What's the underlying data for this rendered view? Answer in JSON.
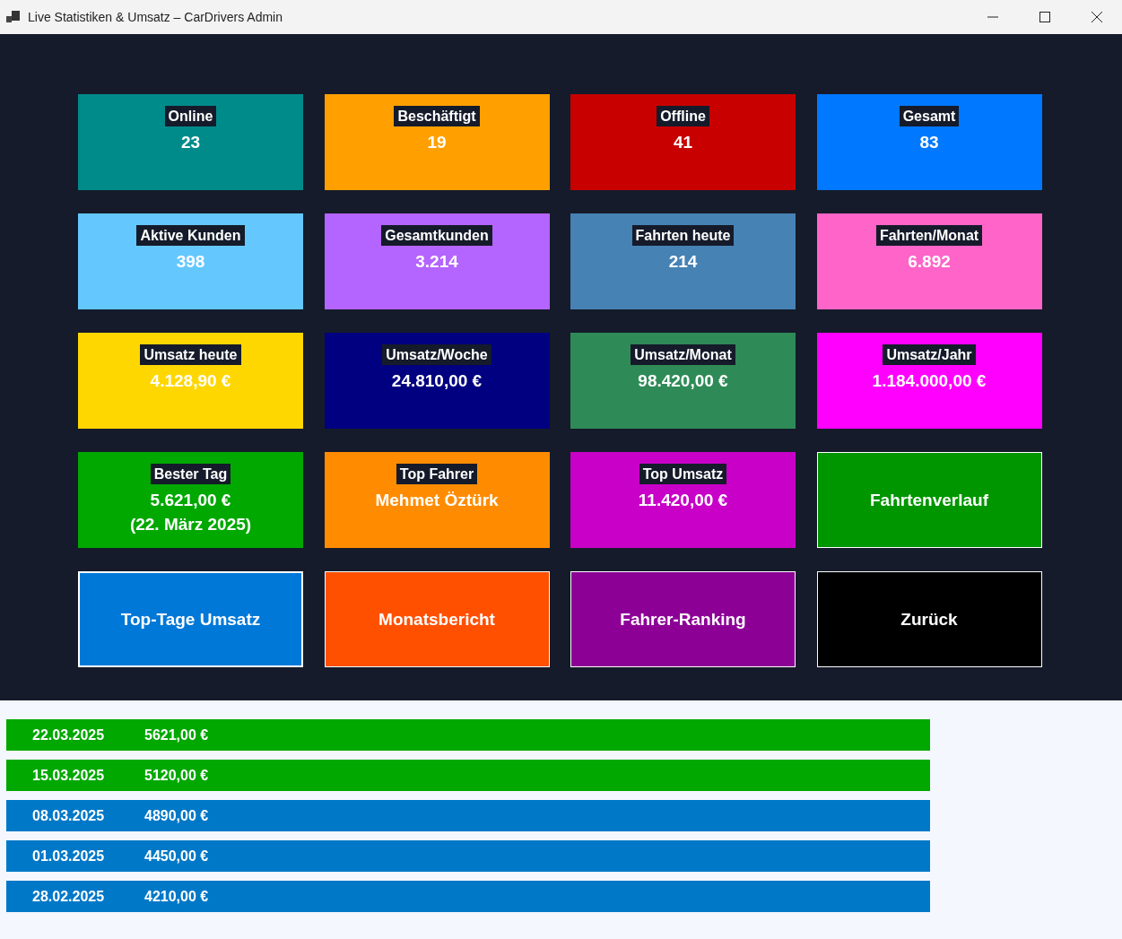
{
  "window": {
    "title": "Live Statistiken & Umsatz – CarDrivers Admin"
  },
  "tiles": [
    {
      "kind": "stat",
      "label": "Online",
      "lines": [
        "23"
      ],
      "color": "#008b8b"
    },
    {
      "kind": "stat",
      "label": "Beschäftigt",
      "lines": [
        "19"
      ],
      "color": "#ffa000"
    },
    {
      "kind": "stat",
      "label": "Offline",
      "lines": [
        "41"
      ],
      "color": "#c80000"
    },
    {
      "kind": "stat",
      "label": "Gesamt",
      "lines": [
        "83"
      ],
      "color": "#0078ff"
    },
    {
      "kind": "stat",
      "label": "Aktive Kunden",
      "lines": [
        "398"
      ],
      "color": "#64c8ff"
    },
    {
      "kind": "stat",
      "label": "Gesamtkunden",
      "lines": [
        "3.214"
      ],
      "color": "#b464ff"
    },
    {
      "kind": "stat",
      "label": "Fahrten heute",
      "lines": [
        "214"
      ],
      "color": "#4682b4"
    },
    {
      "kind": "stat",
      "label": "Fahrten/Monat",
      "lines": [
        "6.892"
      ],
      "color": "#ff64c8"
    },
    {
      "kind": "stat",
      "label": "Umsatz heute",
      "lines": [
        "4.128,90 €"
      ],
      "color": "#ffd700"
    },
    {
      "kind": "stat",
      "label": "Umsatz/Woche",
      "lines": [
        "24.810,00 €"
      ],
      "color": "#000080"
    },
    {
      "kind": "stat",
      "label": "Umsatz/Monat",
      "lines": [
        "98.420,00 €"
      ],
      "color": "#2e8b57"
    },
    {
      "kind": "stat",
      "label": "Umsatz/Jahr",
      "lines": [
        "1.184.000,00 €"
      ],
      "color": "#ff00ff"
    },
    {
      "kind": "stat",
      "label": "Bester Tag",
      "lines": [
        "5.621,00 €",
        "(22. März 2025)"
      ],
      "color": "#00a800"
    },
    {
      "kind": "stat",
      "label": "Top Fahrer",
      "lines": [
        "Mehmet Öztürk"
      ],
      "color": "#ff8c00"
    },
    {
      "kind": "stat",
      "label": "Top Umsatz",
      "lines": [
        "11.420,00 €"
      ],
      "color": "#c800c8"
    },
    {
      "kind": "button",
      "label": "Fahrtenverlauf",
      "color": "#009600",
      "selected": false
    },
    {
      "kind": "button",
      "label": "Top-Tage Umsatz",
      "color": "#0078d7",
      "selected": true
    },
    {
      "kind": "button",
      "label": "Monatsbericht",
      "color": "#ff5000",
      "selected": false
    },
    {
      "kind": "button",
      "label": "Fahrer-Ranking",
      "color": "#8c0096",
      "selected": false
    },
    {
      "kind": "button",
      "label": "Zurück",
      "color": "#000000",
      "selected": false
    }
  ],
  "top_days": [
    {
      "date": "22.03.2025",
      "amount": "5621,00 €",
      "color": "#00a800"
    },
    {
      "date": "15.03.2025",
      "amount": "5120,00 €",
      "color": "#00a800"
    },
    {
      "date": "08.03.2025",
      "amount": "4890,00 €",
      "color": "#0078c8"
    },
    {
      "date": "01.03.2025",
      "amount": "4450,00 €",
      "color": "#0078c8"
    },
    {
      "date": "28.02.2025",
      "amount": "4210,00 €",
      "color": "#0078c8"
    }
  ]
}
